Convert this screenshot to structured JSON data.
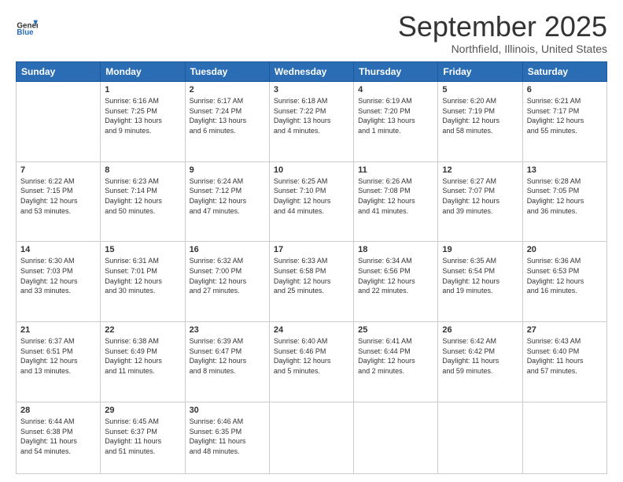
{
  "logo": {
    "line1": "General",
    "line2": "Blue"
  },
  "header": {
    "month": "September 2025",
    "location": "Northfield, Illinois, United States"
  },
  "weekdays": [
    "Sunday",
    "Monday",
    "Tuesday",
    "Wednesday",
    "Thursday",
    "Friday",
    "Saturday"
  ],
  "rows": [
    [
      {
        "day": "",
        "text": ""
      },
      {
        "day": "1",
        "text": "Sunrise: 6:16 AM\nSunset: 7:25 PM\nDaylight: 13 hours\nand 9 minutes."
      },
      {
        "day": "2",
        "text": "Sunrise: 6:17 AM\nSunset: 7:24 PM\nDaylight: 13 hours\nand 6 minutes."
      },
      {
        "day": "3",
        "text": "Sunrise: 6:18 AM\nSunset: 7:22 PM\nDaylight: 13 hours\nand 4 minutes."
      },
      {
        "day": "4",
        "text": "Sunrise: 6:19 AM\nSunset: 7:20 PM\nDaylight: 13 hours\nand 1 minute."
      },
      {
        "day": "5",
        "text": "Sunrise: 6:20 AM\nSunset: 7:19 PM\nDaylight: 12 hours\nand 58 minutes."
      },
      {
        "day": "6",
        "text": "Sunrise: 6:21 AM\nSunset: 7:17 PM\nDaylight: 12 hours\nand 55 minutes."
      }
    ],
    [
      {
        "day": "7",
        "text": "Sunrise: 6:22 AM\nSunset: 7:15 PM\nDaylight: 12 hours\nand 53 minutes."
      },
      {
        "day": "8",
        "text": "Sunrise: 6:23 AM\nSunset: 7:14 PM\nDaylight: 12 hours\nand 50 minutes."
      },
      {
        "day": "9",
        "text": "Sunrise: 6:24 AM\nSunset: 7:12 PM\nDaylight: 12 hours\nand 47 minutes."
      },
      {
        "day": "10",
        "text": "Sunrise: 6:25 AM\nSunset: 7:10 PM\nDaylight: 12 hours\nand 44 minutes."
      },
      {
        "day": "11",
        "text": "Sunrise: 6:26 AM\nSunset: 7:08 PM\nDaylight: 12 hours\nand 41 minutes."
      },
      {
        "day": "12",
        "text": "Sunrise: 6:27 AM\nSunset: 7:07 PM\nDaylight: 12 hours\nand 39 minutes."
      },
      {
        "day": "13",
        "text": "Sunrise: 6:28 AM\nSunset: 7:05 PM\nDaylight: 12 hours\nand 36 minutes."
      }
    ],
    [
      {
        "day": "14",
        "text": "Sunrise: 6:30 AM\nSunset: 7:03 PM\nDaylight: 12 hours\nand 33 minutes."
      },
      {
        "day": "15",
        "text": "Sunrise: 6:31 AM\nSunset: 7:01 PM\nDaylight: 12 hours\nand 30 minutes."
      },
      {
        "day": "16",
        "text": "Sunrise: 6:32 AM\nSunset: 7:00 PM\nDaylight: 12 hours\nand 27 minutes."
      },
      {
        "day": "17",
        "text": "Sunrise: 6:33 AM\nSunset: 6:58 PM\nDaylight: 12 hours\nand 25 minutes."
      },
      {
        "day": "18",
        "text": "Sunrise: 6:34 AM\nSunset: 6:56 PM\nDaylight: 12 hours\nand 22 minutes."
      },
      {
        "day": "19",
        "text": "Sunrise: 6:35 AM\nSunset: 6:54 PM\nDaylight: 12 hours\nand 19 minutes."
      },
      {
        "day": "20",
        "text": "Sunrise: 6:36 AM\nSunset: 6:53 PM\nDaylight: 12 hours\nand 16 minutes."
      }
    ],
    [
      {
        "day": "21",
        "text": "Sunrise: 6:37 AM\nSunset: 6:51 PM\nDaylight: 12 hours\nand 13 minutes."
      },
      {
        "day": "22",
        "text": "Sunrise: 6:38 AM\nSunset: 6:49 PM\nDaylight: 12 hours\nand 11 minutes."
      },
      {
        "day": "23",
        "text": "Sunrise: 6:39 AM\nSunset: 6:47 PM\nDaylight: 12 hours\nand 8 minutes."
      },
      {
        "day": "24",
        "text": "Sunrise: 6:40 AM\nSunset: 6:46 PM\nDaylight: 12 hours\nand 5 minutes."
      },
      {
        "day": "25",
        "text": "Sunrise: 6:41 AM\nSunset: 6:44 PM\nDaylight: 12 hours\nand 2 minutes."
      },
      {
        "day": "26",
        "text": "Sunrise: 6:42 AM\nSunset: 6:42 PM\nDaylight: 11 hours\nand 59 minutes."
      },
      {
        "day": "27",
        "text": "Sunrise: 6:43 AM\nSunset: 6:40 PM\nDaylight: 11 hours\nand 57 minutes."
      }
    ],
    [
      {
        "day": "28",
        "text": "Sunrise: 6:44 AM\nSunset: 6:38 PM\nDaylight: 11 hours\nand 54 minutes."
      },
      {
        "day": "29",
        "text": "Sunrise: 6:45 AM\nSunset: 6:37 PM\nDaylight: 11 hours\nand 51 minutes."
      },
      {
        "day": "30",
        "text": "Sunrise: 6:46 AM\nSunset: 6:35 PM\nDaylight: 11 hours\nand 48 minutes."
      },
      {
        "day": "",
        "text": ""
      },
      {
        "day": "",
        "text": ""
      },
      {
        "day": "",
        "text": ""
      },
      {
        "day": "",
        "text": ""
      }
    ]
  ]
}
